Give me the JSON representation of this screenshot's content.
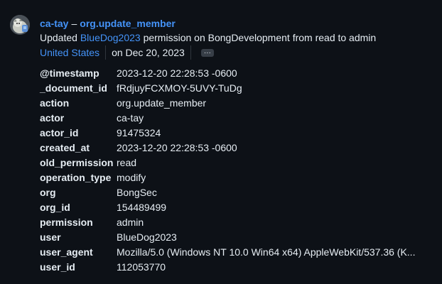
{
  "header": {
    "actor": "ca-tay",
    "separator": "–",
    "action": "org.update_member"
  },
  "summary": {
    "prefix": "Updated ",
    "user": "BlueDog2023",
    "suffix": " permission on BongDevelopment from read to admin"
  },
  "meta": {
    "location": "United States",
    "date": "on Dec 20, 2023",
    "more_label": "···"
  },
  "details": [
    {
      "key": "@timestamp",
      "value": "2023-12-20 22:28:53 -0600"
    },
    {
      "key": "_document_id",
      "value": "fRdjuyFCXMOY-5UVY-TuDg"
    },
    {
      "key": "action",
      "value": "org.update_member"
    },
    {
      "key": "actor",
      "value": "ca-tay"
    },
    {
      "key": "actor_id",
      "value": "91475324"
    },
    {
      "key": "created_at",
      "value": "2023-12-20 22:28:53 -0600"
    },
    {
      "key": "old_permission",
      "value": "read"
    },
    {
      "key": "operation_type",
      "value": "modify"
    },
    {
      "key": "org",
      "value": "BongSec"
    },
    {
      "key": "org_id",
      "value": "154489499"
    },
    {
      "key": "permission",
      "value": "admin"
    },
    {
      "key": "user",
      "value": "BlueDog2023"
    },
    {
      "key": "user_agent",
      "value": "Mozilla/5.0 (Windows NT 10.0 Win64 x64) AppleWebKit/537.36 (K..."
    },
    {
      "key": "user_id",
      "value": "112053770"
    }
  ],
  "colors": {
    "background": "#0d1117",
    "link": "#4493f8",
    "text": "#e6edf3"
  },
  "icons": {
    "avatar": "user-avatar"
  }
}
